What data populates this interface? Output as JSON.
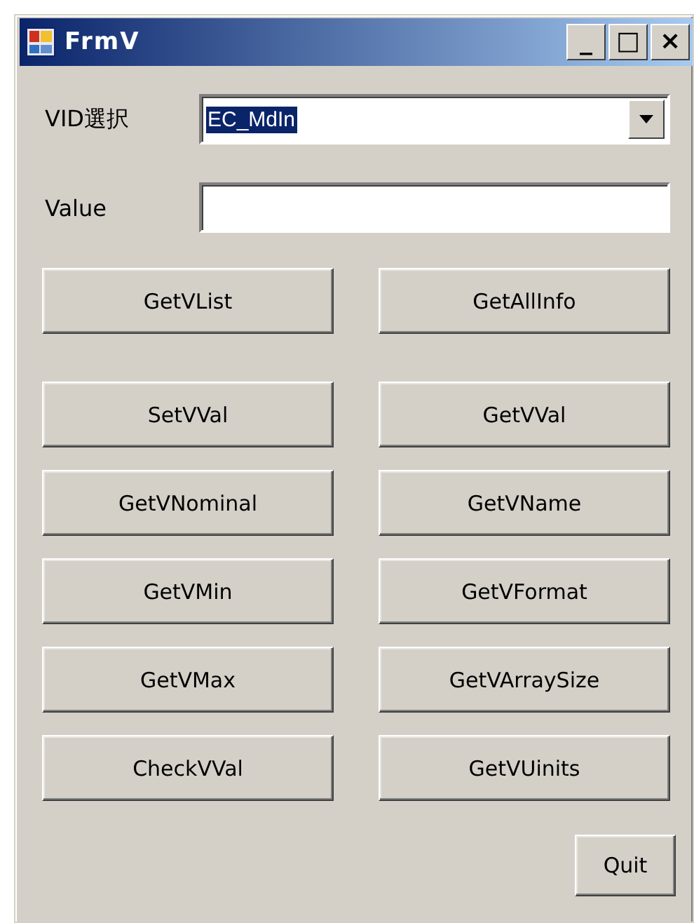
{
  "window": {
    "title": "FrmV",
    "controls": [
      "_",
      "□",
      "×"
    ]
  },
  "vid_select": {
    "label": "VID選択",
    "value": "EC_MdIn",
    "highlighted": true
  },
  "value_field": {
    "label": "Value"
  },
  "buttons": [
    {
      "label": "GetVList"
    },
    {
      "label": "GetAllInfo"
    },
    {
      "label": "SetVVal"
    },
    {
      "label": "GetVVal"
    },
    {
      "label": "GetVNominal"
    },
    {
      "label": "GetVName"
    },
    {
      "label": "GetVMin"
    },
    {
      "label": "GetVFormat"
    },
    {
      "label": "GetVMax"
    },
    {
      "label": "GetVArraySize"
    },
    {
      "label": "CheckVVal"
    },
    {
      "label": "GetVUinits"
    }
  ],
  "quit_button": {
    "label": "Quit"
  }
}
